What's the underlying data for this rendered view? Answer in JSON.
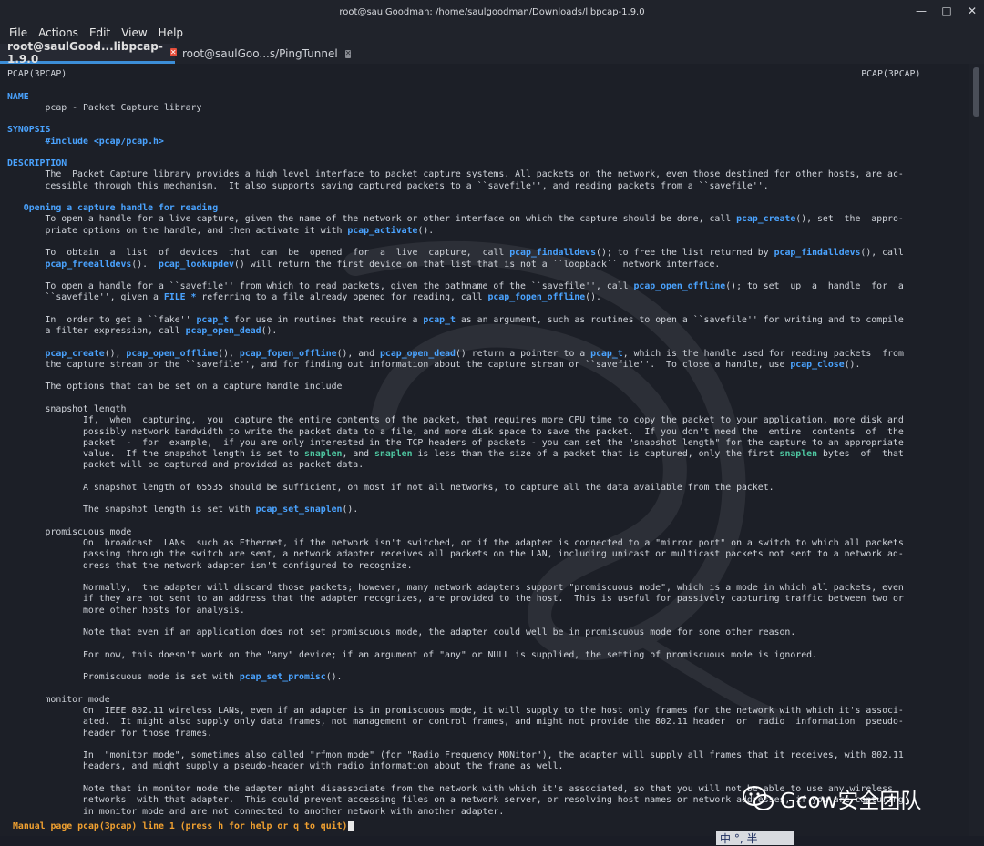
{
  "window": {
    "title": "root@saulGoodman: /home/saulgoodman/Downloads/libpcap-1.9.0"
  },
  "menu": [
    "File",
    "Actions",
    "Edit",
    "View",
    "Help"
  ],
  "tabs": [
    {
      "label": "root@saulGood...libpcap-1.9.0",
      "active": true
    },
    {
      "label": "root@saulGoo...s/PingTunnel",
      "active": false
    }
  ],
  "man": {
    "header_left": "PCAP(3PCAP)",
    "header_right": "PCAP(3PCAP)",
    "sections": {
      "name": "NAME",
      "synopsis": "SYNOPSIS",
      "description": "DESCRIPTION",
      "opening": "Opening a capture handle for reading"
    },
    "name_line": "pcap - Packet Capture library",
    "include_line": "#include <pcap/pcap.h>",
    "desc": [
      "The  Packet Capture library provides a high level interface to packet capture systems. All packets on the network, even those destined for other hosts, are ac-",
      "cessible through this mechanism.  It also supports saving captured packets to a ``savefile'', and reading packets from a ``savefile''."
    ],
    "p1_a": "To open a handle for a live capture, given the name of the network or other interface on which the capture should be done, call ",
    "p1_f1": "pcap_create",
    "p1_b": "(), set  the  appro-",
    "p1_c": "priate options on the handle, and then activate it with ",
    "p1_f2": "pcap_activate",
    "p1_d": "().",
    "p2_a": "To  obtain  a  list  of  devices  that  can  be  opened  for  a  live  capture,  call ",
    "p2_f1": "pcap_findalldevs",
    "p2_b": "(); to free the list returned by ",
    "p2_f2": "pcap_findalldevs",
    "p2_c": "(), call",
    "p2_f3": "pcap_freealldevs",
    "p2_d": "().  ",
    "p2_f4": "pcap_lookupdev",
    "p2_e": "() will return the first device on that list that is not a ``loopback`` network interface.",
    "p3_a": "To open a handle for a ``savefile'' from which to read packets, given the pathname of the ``savefile'', call ",
    "p3_f1": "pcap_open_offline",
    "p3_b": "(); to set  up  a  handle  for  a",
    "p3_c": "``savefile'', given a ",
    "p3_f2": "FILE *",
    "p3_d": " referring to a file already opened for reading, call ",
    "p3_f3": "pcap_fopen_offline",
    "p3_e": "().",
    "p4_a": "In  order to get a ``fake'' ",
    "p4_f1": "pcap_t",
    "p4_b": " for use in routines that require a ",
    "p4_f2": "pcap_t",
    "p4_c": " as an argument, such as routines to open a ``savefile'' for writing and to compile",
    "p4_d": "a filter expression, call ",
    "p4_f3": "pcap_open_dead",
    "p4_e": "().",
    "p5_f1": "pcap_create",
    "p5_a": "(), ",
    "p5_f2": "pcap_open_offline",
    "p5_b": "(), ",
    "p5_f3": "pcap_fopen_offline",
    "p5_c": "(), and ",
    "p5_f4": "pcap_open_dead",
    "p5_d": "() return a pointer to a ",
    "p5_f5": "pcap_t",
    "p5_e": ", which is the handle used for reading packets  from",
    "p5_g": "the capture stream or the ``savefile'', and for finding out information about the capture stream or ``savefile''.  To close a handle, use ",
    "p5_f6": "pcap_close",
    "p5_h": "().",
    "p6": "The options that can be set on a capture handle include",
    "snap_title": "snapshot length",
    "snap1": "If,  when  capturing,  you  capture the entire contents of the packet, that requires more CPU time to copy the packet to your application, more disk and",
    "snap2": "possibly network bandwidth to write the packet data to a file, and more disk space to save the packet.  If you don't need the  entire  contents  of  the",
    "snap3": "packet  -  for  example,  if you are only interested in the TCP headers of packets - you can set the \"snapshot length\" for the capture to an appropriate",
    "snap4_a": "value.  If the snapshot length is set to ",
    "snap4_g1": "snaplen",
    "snap4_b": ", and ",
    "snap4_g2": "snaplen",
    "snap4_c": " is less than the size of a packet that is captured, only the first ",
    "snap4_g3": "snaplen",
    "snap4_d": " bytes  of  that",
    "snap5": "packet will be captured and provided as packet data.",
    "snap6": "A snapshot length of 65535 should be sufficient, on most if not all networks, to capture all the data available from the packet.",
    "snap7_a": "The snapshot length is set with ",
    "snap7_f": "pcap_set_snaplen",
    "snap7_b": "().",
    "promisc_title": "promiscuous mode",
    "pm1": "On  broadcast  LANs  such as Ethernet, if the network isn't switched, or if the adapter is connected to a \"mirror port\" on a switch to which all packets",
    "pm2": "passing through the switch are sent, a network adapter receives all packets on the LAN, including unicast or multicast packets not sent to a network ad-",
    "pm3": "dress that the network adapter isn't configured to recognize.",
    "pm4": "Normally,  the adapter will discard those packets; however, many network adapters support \"promiscuous mode\", which is a mode in which all packets, even",
    "pm5": "if they are not sent to an address that the adapter recognizes, are provided to the host.  This is useful for passively capturing traffic between two or",
    "pm6": "more other hosts for analysis.",
    "pm7": "Note that even if an application does not set promiscuous mode, the adapter could well be in promiscuous mode for some other reason.",
    "pm8": "For now, this doesn't work on the \"any\" device; if an argument of \"any\" or NULL is supplied, the setting of promiscuous mode is ignored.",
    "pm9_a": "Promiscuous mode is set with ",
    "pm9_f": "pcap_set_promisc",
    "pm9_b": "().",
    "monitor_title": "monitor mode",
    "mm1": "On  IEEE 802.11 wireless LANs, even if an adapter is in promiscuous mode, it will supply to the host only frames for the network with which it's associ-",
    "mm2": "ated.  It might also supply only data frames, not management or control frames, and might not provide the 802.11 header  or  radio  information  pseudo-",
    "mm3": "header for those frames.",
    "mm4": "In  \"monitor mode\", sometimes also called \"rfmon mode\" (for \"Radio Frequency MONitor\"), the adapter will supply all frames that it receives, with 802.11",
    "mm5": "headers, and might supply a pseudo-header with radio information about the frame as well.",
    "mm6": "Note that in monitor mode the adapter might disassociate from the network with which it's associated, so that you will not be able to use any wireless",
    "mm7": "networks  with that adapter.  This could prevent accessing files on a network server, or resolving host names or network addresses, if you are capturing",
    "mm8": "in monitor mode and are not connected to another network with another adapter."
  },
  "status": "Manual page pcap(3pcap) line 1 (press h for help or q to quit)",
  "watermark_brand": "Gcow安全团队",
  "ime_text": "中 °, 半",
  "colors": {
    "accent": "#3c8ed8",
    "func": "#4aa3ff",
    "param": "#4ec6a0",
    "status": "#f0a030"
  }
}
